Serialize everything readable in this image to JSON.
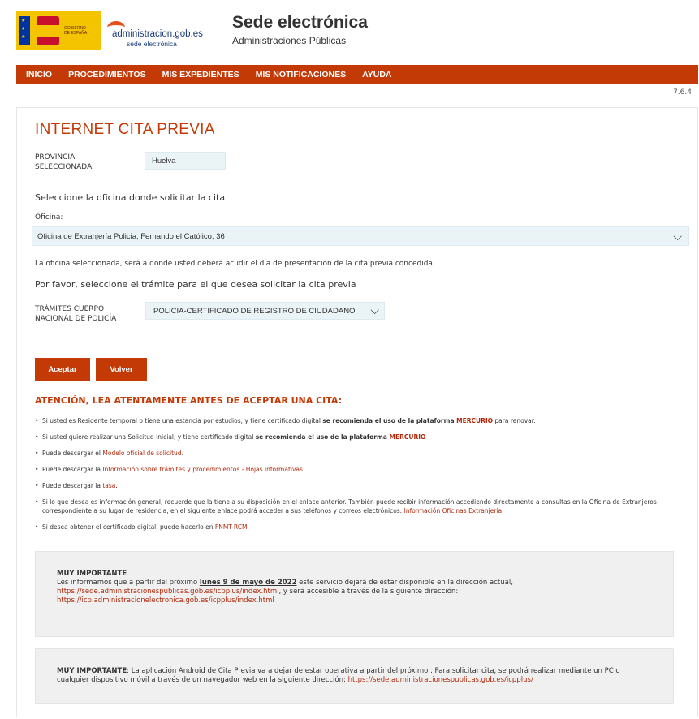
{
  "header": {
    "gov_logo_text": "GOBIERNO DE ESPAÑA",
    "adm_logo_main_a": "ad",
    "adm_logo_main_b": "ministracion.gob.es",
    "adm_logo_sub": "sede electrónica",
    "site_title": "Sede electrónica",
    "site_subtitle": "Administraciones Públicas"
  },
  "nav": {
    "items": [
      "INICIO",
      "PROCEDIMIENTOS",
      "MIS EXPEDIENTES",
      "MIS NOTIFICACIONES",
      "AYUDA"
    ]
  },
  "version": "7.6.4",
  "main": {
    "title": "INTERNET CITA PREVIA",
    "provincia_label_1": "PROVINCIA",
    "provincia_label_2": "SELECCIONADA",
    "provincia_value": "Huelva",
    "select_office_heading": "Seleccione la oficina donde solicitar la cita",
    "oficina_label": "Oficina:",
    "oficina_value": "Oficina de Extranjería Policia, Fernando el Católico, 36",
    "oficina_note": "La oficina seleccionada, será a donde usted deberá acudir el día de presentación de la cita previa concedida.",
    "tramite_heading": "Por favor, seleccione el trámite para el que desea solicitar la cita previa",
    "tramites_label_1": "TRÁMITES CUERPO",
    "tramites_label_2": "NACIONAL DE POLICÍA",
    "tramite_value": "POLICIA-CERTIFICADO DE REGISTRO DE CIUDADANO",
    "btn_aceptar": "Aceptar",
    "btn_volver": "Volver"
  },
  "attention": {
    "title": "ATENCIÓN, LEA ATENTAMENTE ANTES DE ACEPTAR UNA CITA:",
    "b1_a": "Si usted es Residente temporal o tiene una estancia por estudios, y tiene certificado digital ",
    "b1_b": "se recomienda el uso de la plataforma ",
    "b1_link": "MERCURIO",
    "b1_c": " para renovar.",
    "b2_a": "Si usted quiere realizar una Solicitud Inicial, y tiene certificado digital ",
    "b2_b": "se recomienda el uso de la plataforma ",
    "b2_link": "MERCURIO",
    "b3_a": "Puede descargar el ",
    "b3_link": "Modelo oficial de solicitud",
    "b3_c": ".",
    "b4_a": "Puede descargar la ",
    "b4_link": "Información sobre trámites y procedimientos - Hojas Informativas",
    "b4_c": ".",
    "b5_a": "Puede descargar la ",
    "b5_link": "tasa",
    "b5_c": ".",
    "b6_a": "Si lo que desea es información general, recuerde que la tiene a su disposición en el enlace anterior. También puede recibir información accediendo directamente a consultas en la Oficina de Extranjeros correspondiente a su lugar de residencia, en el siguiente enlace podrá acceder a sus teléfonos y correos electrónicos: ",
    "b6_link": "Información Oficinas Extranjería",
    "b6_c": ".",
    "b7_a": "Si desea obtener el certificado digital, puede hacerlo en ",
    "b7_link": "FNMT-RCM",
    "b7_c": "."
  },
  "notice1": {
    "heading": "MUY IMPORTANTE",
    "text_a": "Les informamos que a partir del próximo ",
    "date": "lunes 9 de mayo de 2022",
    "text_b": " este servicio dejará de estar disponible en la dirección actual,",
    "url1": "https://sede.administracionespublicas.gob.es/icpplus/index.html",
    "text_c": ", y será accesible a través de la siguiente dirección:",
    "url2": "https://icp.administracionelectronica.gob.es/icpplus/index.html"
  },
  "notice2": {
    "heading": "MUY IMPORTANTE",
    "text": ": La aplicación Android de Cita Previa va a dejar de estar operativa a partir del próximo . Para solicitar cita, se podrá realizar mediante un PC o cualquier dispositivo móvil a través de un navegador web en la siguiente dirección: ",
    "url": "https://sede.administracionespublicas.gob.es/icpplus/"
  }
}
